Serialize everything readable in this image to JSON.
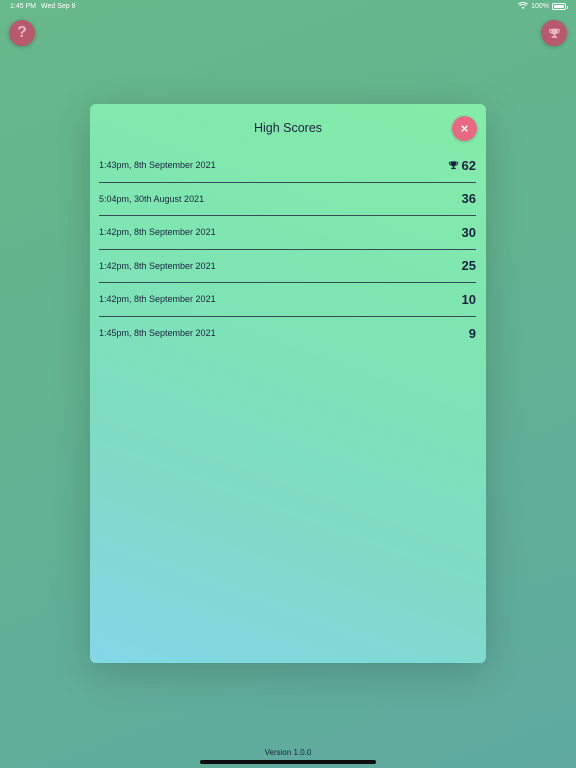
{
  "status": {
    "time": "1:45 PM",
    "date": "Wed Sep 8",
    "battery": "100%",
    "battery_level": 1.0,
    "icons": [
      "wifi-icon",
      "battery-icon"
    ]
  },
  "buttons": {
    "help_symbol": "?",
    "help_icon": "question-icon",
    "trophy_icon": "trophy-icon",
    "close_symbol": "×"
  },
  "modal": {
    "title": "High Scores",
    "scores": [
      {
        "date": "1:43pm, 8th September 2021",
        "score": "62",
        "best": true
      },
      {
        "date": "5:04pm, 30th August 2021",
        "score": "36",
        "best": false
      },
      {
        "date": "1:42pm, 8th September 2021",
        "score": "30",
        "best": false
      },
      {
        "date": "1:42pm, 8th September 2021",
        "score": "25",
        "best": false
      },
      {
        "date": "1:42pm, 8th September 2021",
        "score": "10",
        "best": false
      },
      {
        "date": "1:45pm, 8th September 2021",
        "score": "9",
        "best": false
      }
    ]
  },
  "footer": {
    "version": "Version 1.0.0"
  },
  "colors": {
    "accent_button": "#e86a82",
    "corner_button": "#b8596d",
    "text": "#1d2340"
  }
}
